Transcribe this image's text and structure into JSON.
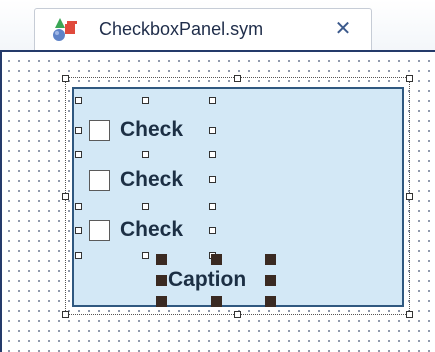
{
  "tab": {
    "title": "CheckboxPanel.sym",
    "close_glyph": "✕",
    "icon": "symbol-file-icon"
  },
  "panel": {
    "background": "#d3e8f6",
    "border": "#2f5880",
    "checkboxes": [
      {
        "label": "Check",
        "checked": false
      },
      {
        "label": "Check",
        "checked": false
      },
      {
        "label": "Check",
        "checked": false
      }
    ],
    "caption": "Caption"
  }
}
